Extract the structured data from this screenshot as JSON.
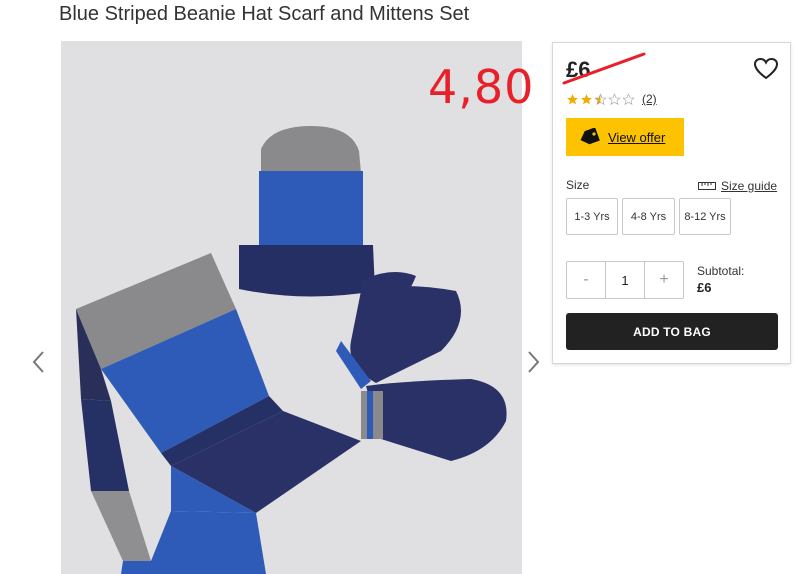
{
  "product": {
    "title": "Blue Striped Beanie Hat Scarf and Mittens Set"
  },
  "annotation": {
    "handwritten_price": "4,80"
  },
  "panel": {
    "price": "£6",
    "rating": {
      "value": 2.5,
      "max": 5,
      "review_count": "(2)"
    },
    "offer_label": "View offer",
    "size_label": "Size",
    "size_guide_label": "Size guide",
    "sizes": [
      "1-3 Yrs",
      "4-8 Yrs",
      "8-12 Yrs"
    ],
    "quantity": {
      "minus": "-",
      "value": "1",
      "plus": "+"
    },
    "subtotal_label": "Subtotal:",
    "subtotal_value": "£6",
    "add_to_bag_label": "ADD TO BAG"
  },
  "colors": {
    "offer_bg": "#fdc300",
    "button_bg": "#222222",
    "handwriting": "#e8202a",
    "star": "#f2a900"
  }
}
